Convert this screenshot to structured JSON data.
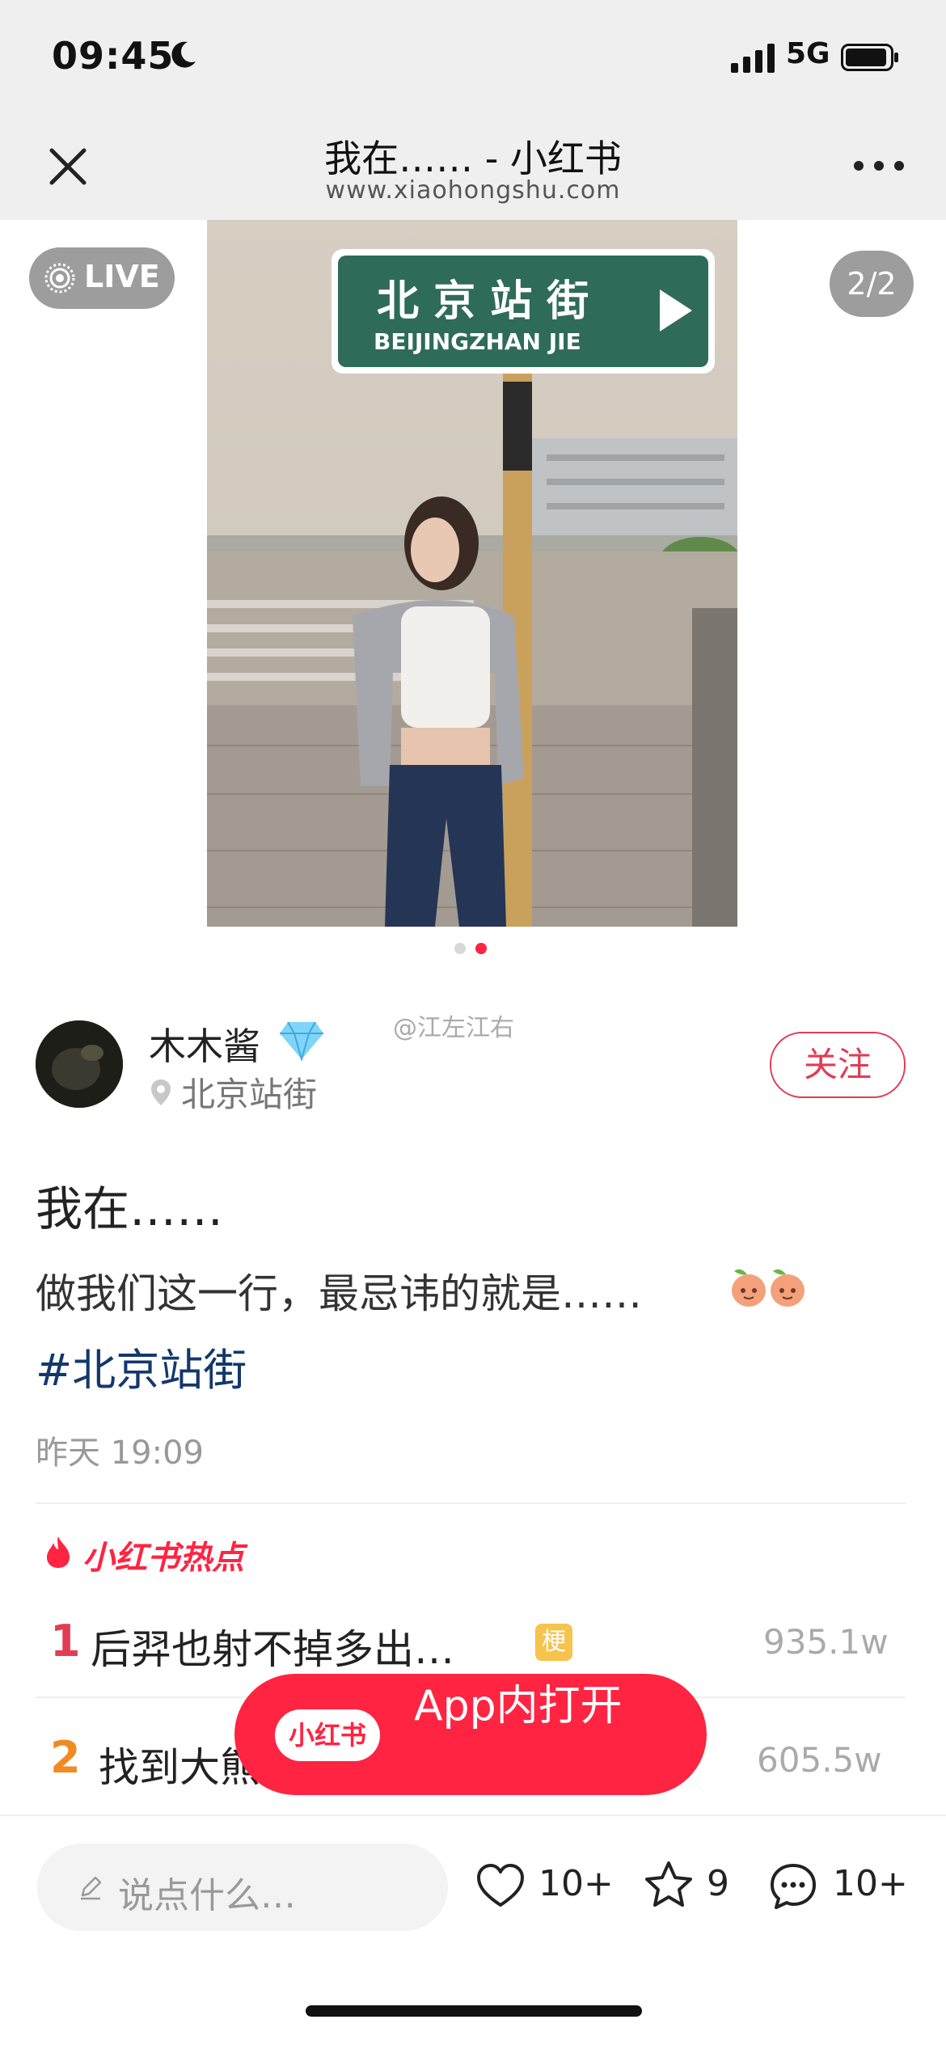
{
  "status_bar": {
    "time": "09:45",
    "network": "5G"
  },
  "browser": {
    "title": "我在…… - 小红书",
    "url": "www.xiaohongshu.com"
  },
  "media": {
    "live_label": "LIVE",
    "counter": "2/2",
    "active_dot": 2,
    "total_dots": 2
  },
  "author": {
    "name": "木木酱",
    "location": "北京站街",
    "follow_label": "关注"
  },
  "watermark": "@江左江右",
  "post": {
    "title": "我在……",
    "body": "做我们这一行，最忌讳的就是……",
    "hashtag": "#北京站街",
    "time": "昨天 19:09"
  },
  "hot_list": {
    "title": "小红书热点",
    "items": [
      {
        "rank": "1",
        "text": "后羿也射不掉多出…",
        "tag": "梗",
        "count": "935.1w"
      },
      {
        "rank": "2",
        "text": "找到大熊",
        "count": "605.5w"
      }
    ]
  },
  "open_app": {
    "logo": "小红书",
    "label": "App内打开"
  },
  "bottom_bar": {
    "comment_placeholder": "说点什么…",
    "likes": "10+",
    "favorites": "9",
    "comments": "10+"
  },
  "colors": {
    "brand": "#ff2442",
    "hashtag": "#13386c",
    "rank1": "#e23c54",
    "rank2": "#f08a22"
  }
}
